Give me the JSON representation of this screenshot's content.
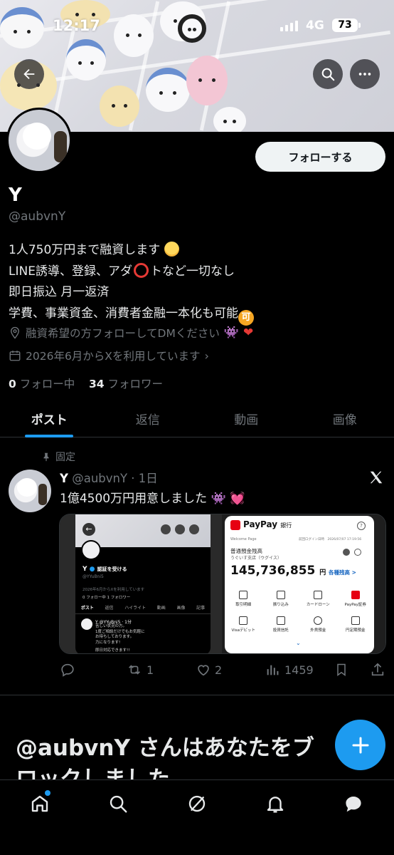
{
  "status_bar": {
    "time": "12:17",
    "network": "4G",
    "battery": "73"
  },
  "profile": {
    "follow_label": "フォローする",
    "name": "Y",
    "handle": "@aubvnY",
    "bio_lines": [
      "1人750万円まで融資します",
      "LINE誘導、登録、アダ",
      "トなど一切なし",
      "即日振込 月一返済",
      "学費、事業資金、消費者金融一本化も可能"
    ],
    "location": "融資希望の方フォローしてDMください",
    "joined": "2026年6月からXを利用しています",
    "following_count": "0",
    "following_label": "フォロー中",
    "followers_count": "34",
    "followers_label": "フォロワー"
  },
  "tabs": [
    {
      "label": "ポスト",
      "active": true
    },
    {
      "label": "返信",
      "active": false
    },
    {
      "label": "動画",
      "active": false
    },
    {
      "label": "画像",
      "active": false
    }
  ],
  "post": {
    "pinned_label": "固定",
    "author": "Y",
    "handle_time": "@aubvnY · 1日",
    "text": "1億4500万円用意しました",
    "actions": {
      "reply": "",
      "retweet": "1",
      "like": "2",
      "views": "1459"
    },
    "media_left": {
      "name": "Y",
      "verify": "認証を受ける",
      "handle": "@YYuBni5",
      "joined": "2026年6月からXを利用しています",
      "counts": "0 フォロー中  1 フォロワー",
      "tabs": [
        "ポスト",
        "返信",
        "ハイライト",
        "動画",
        "画像",
        "記事"
      ],
      "post_head": "Y @YYuBni5 · 1分",
      "post_lines": [
        "苦しい状況の方。",
        "1度ご相談だけでもお気軽に",
        "お待ちしております。",
        "力になります!",
        "即日対応できます!!"
      ]
    },
    "media_right": {
      "bank": "PayPay",
      "bank_suffix": "銀行",
      "welcome": "Welcome Page",
      "last_login": "前回ログイン日時　2026/07/07 17:19:56",
      "account": "普通預金残高",
      "branch": "うぐいす支店（ウグイス）",
      "balance": "145,736,855",
      "yen": "円",
      "each": "各種残高 >",
      "menu": [
        "取引明細",
        "振り込み",
        "カードローン",
        "PayPay証券",
        "Visaデビット",
        "投資信託",
        "外貨預金",
        "円定期預金"
      ]
    }
  },
  "blocked_text_line1": "@aubvnY さんはあなたをブ",
  "blocked_text_line2": "ロックしました",
  "colors": {
    "accent": "#1d9bf0",
    "background": "#000000",
    "muted": "#71767b",
    "text": "#e7e9ea",
    "paypay_red": "#e60012"
  },
  "icons": [
    "back-arrow-icon",
    "search-icon",
    "more-icon",
    "location-icon",
    "calendar-icon",
    "pin-icon",
    "x-logo-icon",
    "reply-icon",
    "retweet-icon",
    "like-icon",
    "views-icon",
    "bookmark-icon",
    "share-icon",
    "plus-icon",
    "home-icon",
    "explore-icon",
    "grok-icon",
    "notifications-icon",
    "messages-icon"
  ]
}
